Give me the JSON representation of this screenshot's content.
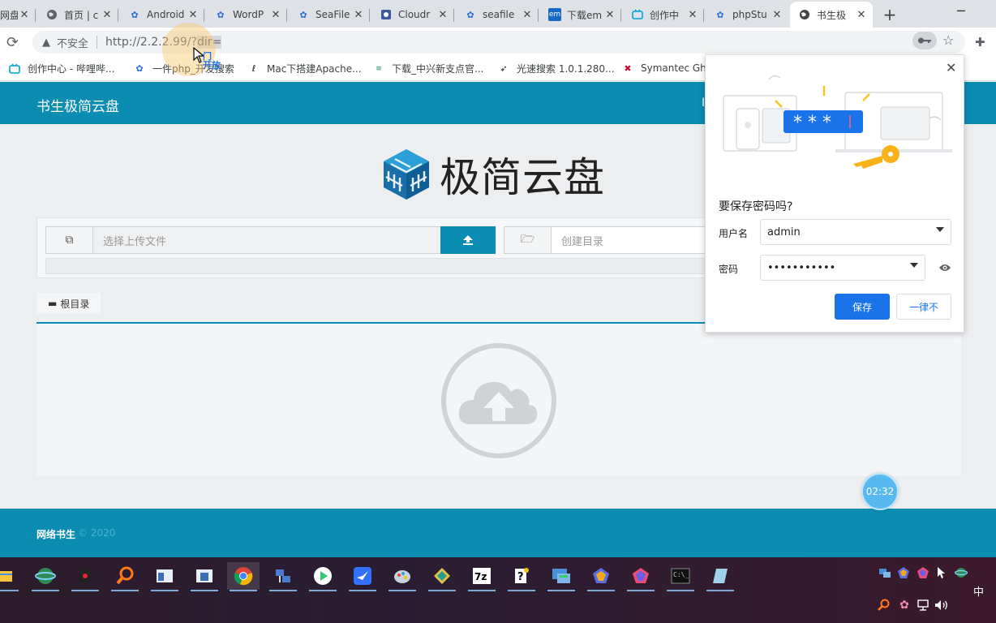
{
  "browser": {
    "tabs": [
      {
        "label": "网盘",
        "icon": "page-icon"
      },
      {
        "label": "首页 | c",
        "icon": "globe-icon"
      },
      {
        "label": "Android",
        "icon": "baidu-paw-icon"
      },
      {
        "label": "WordP",
        "icon": "baidu-paw-icon"
      },
      {
        "label": "SeaFile",
        "icon": "baidu-paw-icon"
      },
      {
        "label": "Cloudr",
        "icon": "cloudreve-icon"
      },
      {
        "label": "seafile",
        "icon": "baidu-paw-icon"
      },
      {
        "label": "下载em",
        "icon": "em-icon"
      },
      {
        "label": "创作中",
        "icon": "bilibili-icon"
      },
      {
        "label": "phpStu",
        "icon": "baidu-paw-icon"
      },
      {
        "label": "书生极",
        "icon": "globe-icon"
      }
    ],
    "active_tab_index": 10,
    "new_tab_label": "+",
    "address": {
      "security_label": "不安全",
      "url_host": "http://2.2.2.99/?",
      "url_selected": "dir="
    },
    "bookmarks": [
      {
        "label": "创作中心 - 哔哩哔...",
        "icon": "bilibili-icon"
      },
      {
        "label": "一件php_开发搜索",
        "icon": "baidu-paw-icon"
      },
      {
        "label": "Mac下搭建Apache...",
        "icon": "feather-icon"
      },
      {
        "label": "下载_中兴新支点官...",
        "icon": "zte-icon"
      },
      {
        "label": "光速搜索 1.0.1.280...",
        "icon": "rocket-icon"
      },
      {
        "label": "Symantec Gho",
        "icon": "symantec-icon"
      }
    ],
    "cursor_tooltip": "门\n开放"
  },
  "site": {
    "brand": "书生极简云盘",
    "nav_partial": "I",
    "logo_text": "极简云盘",
    "upload": {
      "file_placeholder": "选择上传文件",
      "dir_placeholder": "创建目录"
    },
    "breadcrumb_root": "根目录",
    "footer": {
      "brand": "网络书生",
      "copyright": "© 2020"
    }
  },
  "password_popup": {
    "title": "要保存密码吗?",
    "username_label": "用户名",
    "username_value": "admin",
    "password_label": "密码",
    "password_value": "•••••••••••",
    "save_label": "保存",
    "never_label": "一律不"
  },
  "overlay": {
    "timer": "02:32"
  },
  "taskbar": {
    "ime_label": "中",
    "colors": {
      "accent": "#0a8cb3",
      "popup_blue": "#1a73e8"
    }
  }
}
